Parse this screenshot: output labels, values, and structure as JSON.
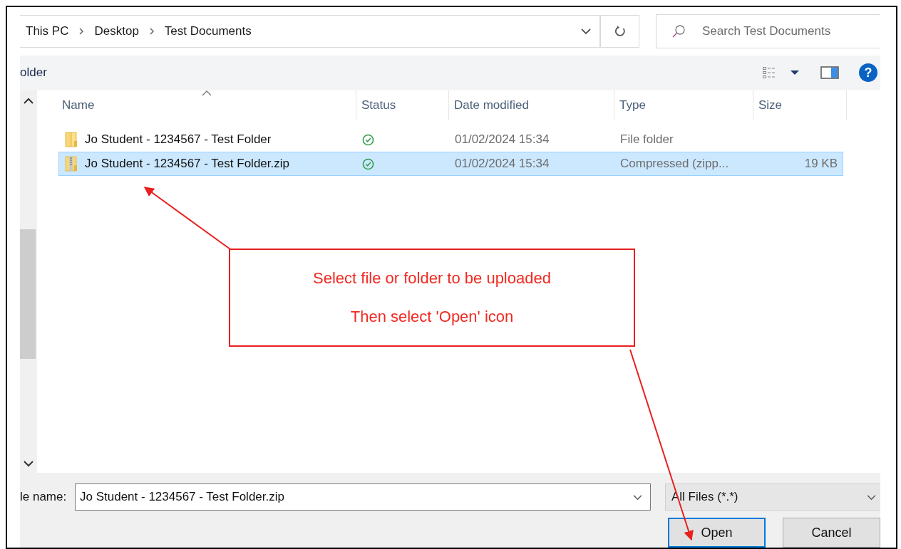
{
  "address_bar": {
    "breadcrumbs": [
      "This PC",
      "Desktop",
      "Test Documents"
    ]
  },
  "search": {
    "placeholder": "Search Test Documents"
  },
  "toolbar": {
    "label": "older",
    "help": "?"
  },
  "columns": [
    {
      "label": "Name",
      "sorted": true
    },
    {
      "label": "Status",
      "sorted": false
    },
    {
      "label": "Date modified",
      "sorted": false
    },
    {
      "label": "Type",
      "sorted": false
    },
    {
      "label": "Size",
      "sorted": false
    }
  ],
  "files": [
    {
      "name": "Jo Student - 1234567 - Test Folder",
      "kind": "folder",
      "date": "01/02/2024 15:34",
      "type": "File folder",
      "selected": false
    },
    {
      "name": "Jo Student - 1234567 - Test Folder.zip",
      "kind": "zip",
      "date": "01/02/2024 15:34",
      "type": "Compressed (zipp...",
      "size": "19 KB",
      "selected": true
    }
  ],
  "file_name": {
    "label": "le name:",
    "value": "Jo Student - 1234567 - Test Folder.zip"
  },
  "file_type": {
    "value": "All Files (*.*)"
  },
  "buttons": [
    {
      "label": "Open",
      "default": true
    },
    {
      "label": "Cancel",
      "default": false
    }
  ],
  "annotation": {
    "lines": [
      "Select file or folder to be uploaded",
      "Then select 'Open' icon"
    ]
  }
}
